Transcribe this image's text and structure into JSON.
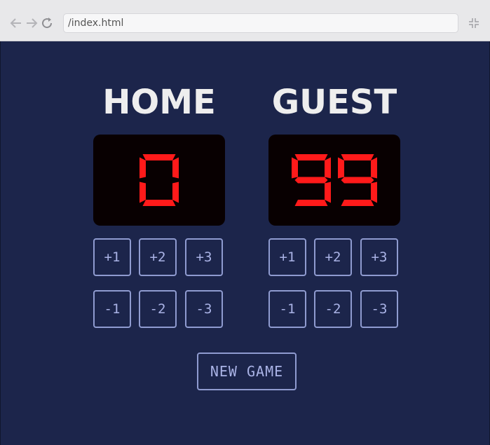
{
  "browser": {
    "url": "/index.html"
  },
  "home": {
    "title": "HOME",
    "score": "0",
    "add_buttons": [
      "+1",
      "+2",
      "+3"
    ],
    "sub_buttons": [
      "-1",
      "-2",
      "-3"
    ]
  },
  "guest": {
    "title": "GUEST",
    "score": "99",
    "add_buttons": [
      "+1",
      "+2",
      "+3"
    ],
    "sub_buttons": [
      "-1",
      "-2",
      "-3"
    ]
  },
  "new_game_label": "NEW GAME",
  "colors": {
    "background": "#1c254b",
    "score_digits": "#ff1a1a",
    "score_background": "#080001",
    "button_border": "#8f9bd0",
    "title_text": "#eeeeee"
  }
}
